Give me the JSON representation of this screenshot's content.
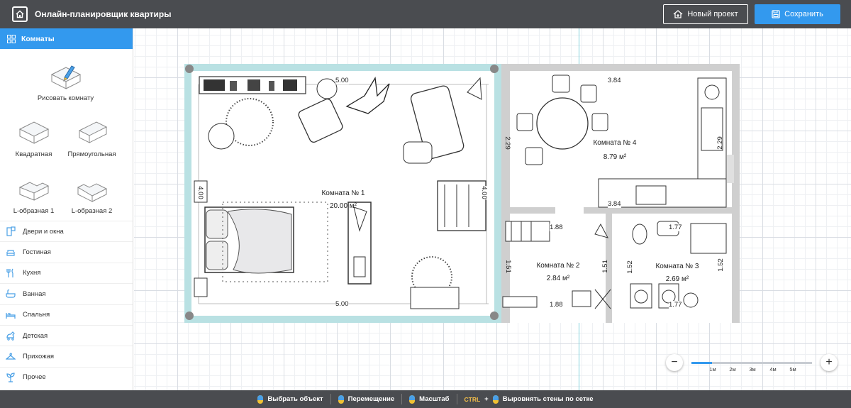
{
  "header": {
    "title": "Онлайн-планировщик квартиры",
    "new_project": "Новый проект",
    "save": "Сохранить"
  },
  "sidebar": {
    "active": "Комнаты",
    "tiles": [
      {
        "label": "Рисовать комнату",
        "icon": "draw-room-icon"
      },
      {
        "label": "Квадратная",
        "icon": "square-room-icon"
      },
      {
        "label": "Прямоугольная",
        "icon": "rect-room-icon"
      },
      {
        "label": "L-образная 1",
        "icon": "l-room-1-icon"
      },
      {
        "label": "L-образная 2",
        "icon": "l-room-2-icon"
      }
    ],
    "items": [
      {
        "label": "Двери и окна",
        "icon": "door-window-icon"
      },
      {
        "label": "Гостиная",
        "icon": "sofa-icon"
      },
      {
        "label": "Кухня",
        "icon": "cutlery-icon"
      },
      {
        "label": "Ванная",
        "icon": "bathtub-icon"
      },
      {
        "label": "Спальня",
        "icon": "bed-icon"
      },
      {
        "label": "Детская",
        "icon": "toy-icon"
      },
      {
        "label": "Прихожая",
        "icon": "hanger-icon"
      },
      {
        "label": "Прочее",
        "icon": "plant-icon"
      }
    ]
  },
  "plan": {
    "rooms": [
      {
        "name": "Комната № 1",
        "area": "20.00 м²"
      },
      {
        "name": "Комната № 2",
        "area": "2.84 м²"
      },
      {
        "name": "Комната № 3",
        "area": "2.69 м²"
      },
      {
        "name": "Комната № 4",
        "area": "8.79 м²"
      }
    ],
    "dims": {
      "r1_top": "5.00",
      "r1_bottom": "5.00",
      "r1_left": "4.00",
      "r1_right": "4.00",
      "r4_top": "3.84",
      "r4_bottom": "3.84",
      "r4_left": "2.29",
      "r4_right": "2.29",
      "r2_top": "1.88",
      "r2_bottom": "1.88",
      "r2_left": "1.51",
      "r2_right": "1.51",
      "r3_top": "1.77",
      "r3_bottom": "1.77",
      "r3_left": "1.52",
      "r3_right": "1.52"
    }
  },
  "zoom": {
    "ticks": [
      "1м",
      "2м",
      "3м",
      "4м",
      "5м"
    ],
    "level": 0.17,
    "minus": "−",
    "plus": "+"
  },
  "footer": {
    "select": "Выбрать объект",
    "move": "Перемещение",
    "scale": "Масштаб",
    "ctrl": "CTRL",
    "plus": "+",
    "align": "Выровнять стены по сетке"
  }
}
